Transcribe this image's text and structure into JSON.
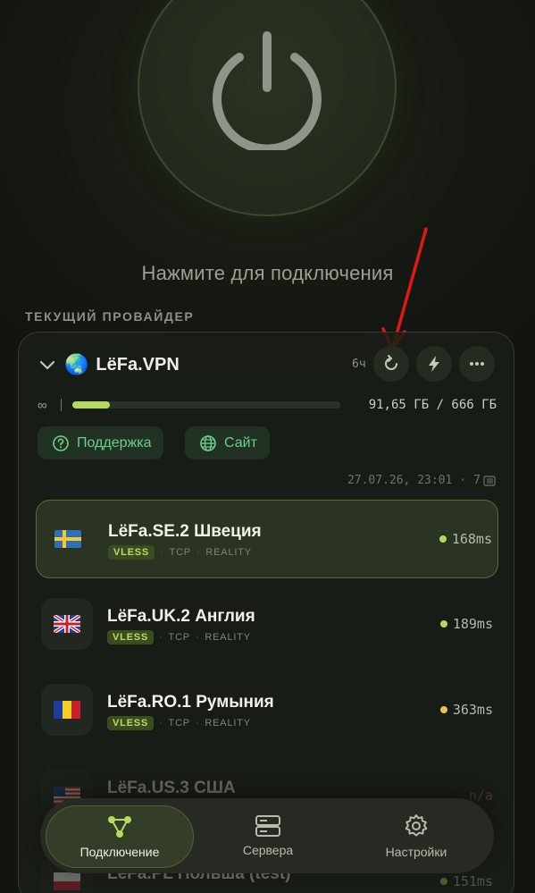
{
  "hero": {
    "hint": "Нажмите для подключения"
  },
  "provider": {
    "section_label": "ТЕКУЩИЙ ПРОВАЙДЕР",
    "name": "LёFa.VPN",
    "update_interval": "6ч",
    "traffic_limit": "∞",
    "traffic_text": "91,65 ГБ / 666 ГБ",
    "traffic_fraction": 0.14,
    "support_label": "Поддержка",
    "site_label": "Сайт",
    "updated_at": "27.07.26, 23:01",
    "servers_count": "7"
  },
  "servers": [
    {
      "name": "LёFa.SE.2 Швеция",
      "flag": "SE",
      "protocol": "VLESS",
      "transport": "TCP",
      "security": "REALITY",
      "ping": "168ms",
      "ping_color": "#b4db5a",
      "active": true
    },
    {
      "name": "LёFa.UK.2 Англия",
      "flag": "UK",
      "protocol": "VLESS",
      "transport": "TCP",
      "security": "REALITY",
      "ping": "189ms",
      "ping_color": "#b4db5a",
      "active": false
    },
    {
      "name": "LёFa.RO.1 Румыния",
      "flag": "RO",
      "protocol": "VLESS",
      "transport": "TCP",
      "security": "REALITY",
      "ping": "363ms",
      "ping_color": "#e8c24d",
      "active": false
    },
    {
      "name": "LёFa.US.3 США",
      "flag": "US",
      "ping": "n/a",
      "ping_color": "#c0553f",
      "active": false
    },
    {
      "name": "LёFa.PL Польша (test)",
      "flag": "PL",
      "ping": "151ms",
      "ping_color": "#b4db5a",
      "active": false
    }
  ],
  "nav": {
    "connection": "Подключение",
    "servers": "Сервера",
    "settings": "Настройки"
  },
  "colors": {
    "accent": "#b4db5a",
    "support_green": "#6ccf88",
    "arrow_red": "#e01818"
  }
}
